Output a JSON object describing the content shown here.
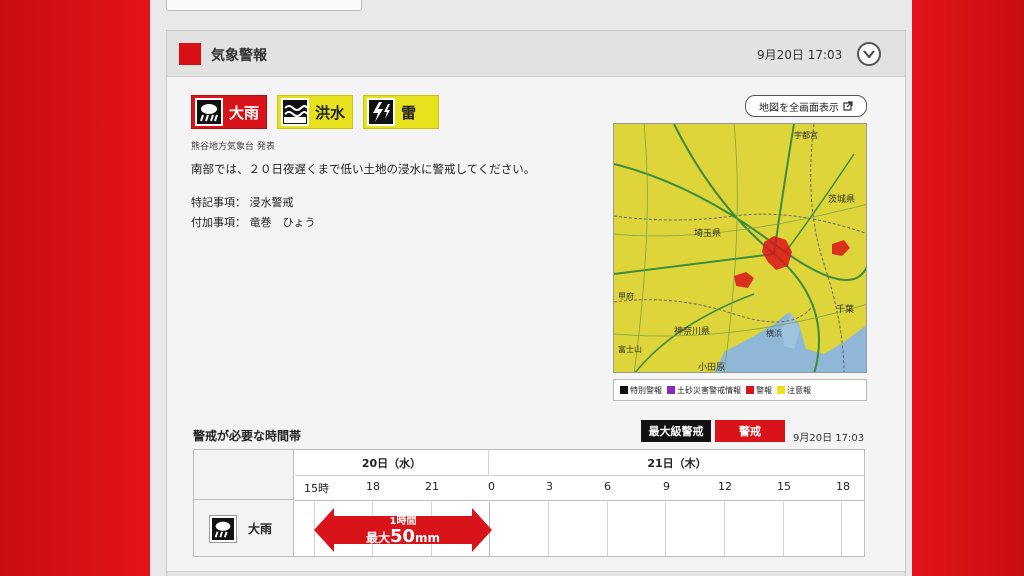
{
  "header": {
    "title": "気象警報",
    "timestamp": "9月20日 17:03"
  },
  "warnings": [
    {
      "label": "大雨",
      "icon": "heavy-rain-icon",
      "color": "#d8141a"
    },
    {
      "label": "洪水",
      "icon": "flood-icon",
      "color": "#e8e21e"
    },
    {
      "label": "雷",
      "icon": "thunder-icon",
      "color": "#e8e21e"
    }
  ],
  "issuer": "熊谷地方気象台 発表",
  "message": "南部では、２０日夜遅くまで低い土地の浸水に警戒してください。",
  "special_notes": "特記事項： 浸水警戒",
  "additional_notes": "付加事項： 竜巻　ひょう",
  "map": {
    "fullscreen_label": "地図を全画面表示",
    "place_labels": {
      "saitama": "埼玉県",
      "ibaraki": "茨城県",
      "chiba": "千葉",
      "kanagawa": "神奈川県",
      "odawara": "小田原",
      "fujisan": "富士山",
      "kofu": "甲府",
      "utsunomiya": "宇都宮",
      "yokohama": "横浜"
    },
    "legend": [
      {
        "label": "特別警報",
        "color": "#111111"
      },
      {
        "label": "土砂災害警戒情報",
        "color": "#8a2bb8"
      },
      {
        "label": "警報",
        "color": "#d8141a"
      },
      {
        "label": "注意報",
        "color": "#e8e21e"
      }
    ]
  },
  "timeline": {
    "title": "警戒が必要な時間帯",
    "key_max": "最大級警戒",
    "key_warn": "警戒",
    "timestamp": "9月20日 17:03",
    "day1": "20日（水）",
    "day2": "21日（木）",
    "hours": [
      "15時",
      "18",
      "21",
      "0",
      "3",
      "6",
      "9",
      "12",
      "15",
      "18"
    ],
    "row_label": "大雨",
    "arrow_line1": "1時間",
    "arrow_prefix": "最大",
    "arrow_value": "50",
    "arrow_unit": "mm"
  }
}
